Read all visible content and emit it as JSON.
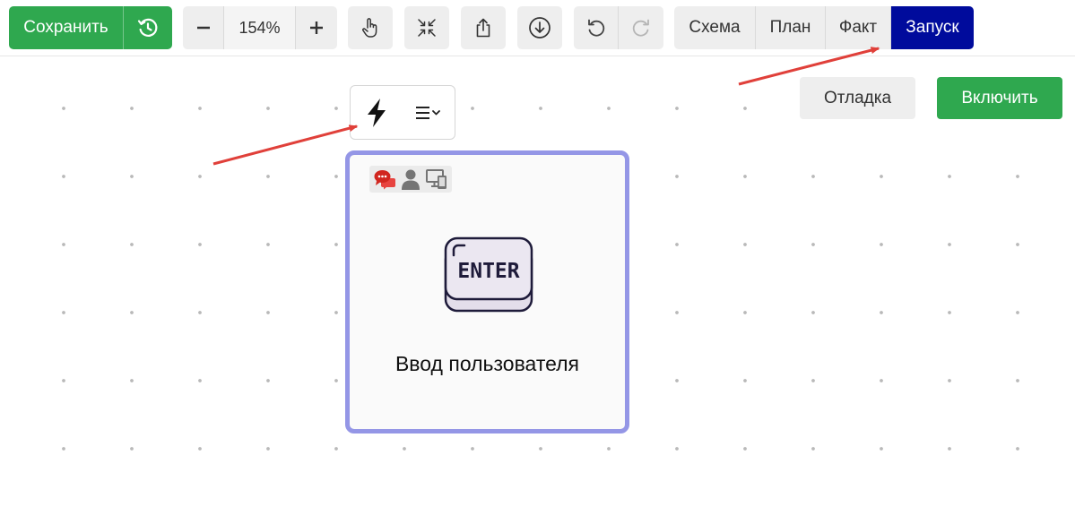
{
  "toolbar": {
    "save_label": "Сохранить",
    "history_icon": "history-clock-icon",
    "zoom": {
      "minus": "−",
      "level": "154%",
      "plus": "+"
    },
    "tools": [
      "hand-pointer-icon",
      "fit-arrows-icon",
      "share-export-icon",
      "download-circle-icon",
      "undo-icon",
      "redo-icon"
    ],
    "modes": [
      {
        "label": "Схема",
        "active": false
      },
      {
        "label": "План",
        "active": false
      },
      {
        "label": "Факт",
        "active": false
      },
      {
        "label": "Запуск",
        "active": true
      }
    ]
  },
  "actions": {
    "debug_label": "Отладка",
    "enable_label": "Включить"
  },
  "node_toolbar": {
    "items": [
      "lightning-icon",
      "list-menu-icon"
    ]
  },
  "node": {
    "badges": [
      "chat-bubbles-icon",
      "user-icon",
      "devices-icon"
    ],
    "key_text": "ENTER",
    "label": "Ввод пользователя"
  },
  "colors": {
    "green": "#2fa84f",
    "active_tab": "#000b9c",
    "node_border": "#9496e6",
    "arrow": "#e0403a"
  }
}
